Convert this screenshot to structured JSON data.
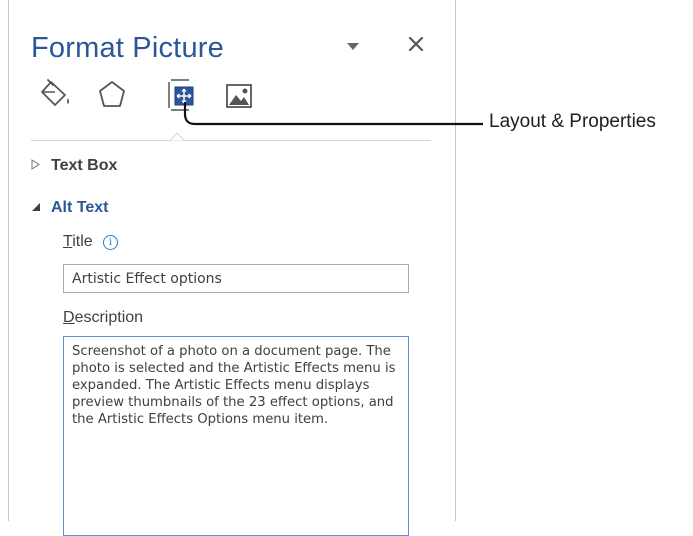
{
  "pane": {
    "title": "Format Picture",
    "tabs": [
      {
        "icon": "fill-line-icon",
        "label": "Fill & Line"
      },
      {
        "icon": "effects-icon",
        "label": "Effects"
      },
      {
        "icon": "layout-properties-icon",
        "label": "Layout & Properties",
        "selected": true
      },
      {
        "icon": "picture-icon",
        "label": "Picture"
      }
    ],
    "sections": {
      "text_box": {
        "label": "Text Box",
        "expanded": false
      },
      "alt_text": {
        "label": "Alt Text",
        "expanded": true
      }
    },
    "alt_text": {
      "title_label_ul": "T",
      "title_label_rest": "itle",
      "title_value": "Artistic Effect options",
      "description_label_ul": "D",
      "description_label_rest": "escription",
      "description_value": "Screenshot of a photo on a document page. The photo is selected and the Artistic Effects menu is expanded. The Artistic Effects menu displays preview thumbnails of the 23 effect options, and the Artistic Effects Options menu item."
    }
  },
  "callout": {
    "label": "Layout & Properties"
  },
  "colors": {
    "accent": "#2b579a",
    "text": "#404040",
    "info": "#2b7cd3"
  }
}
